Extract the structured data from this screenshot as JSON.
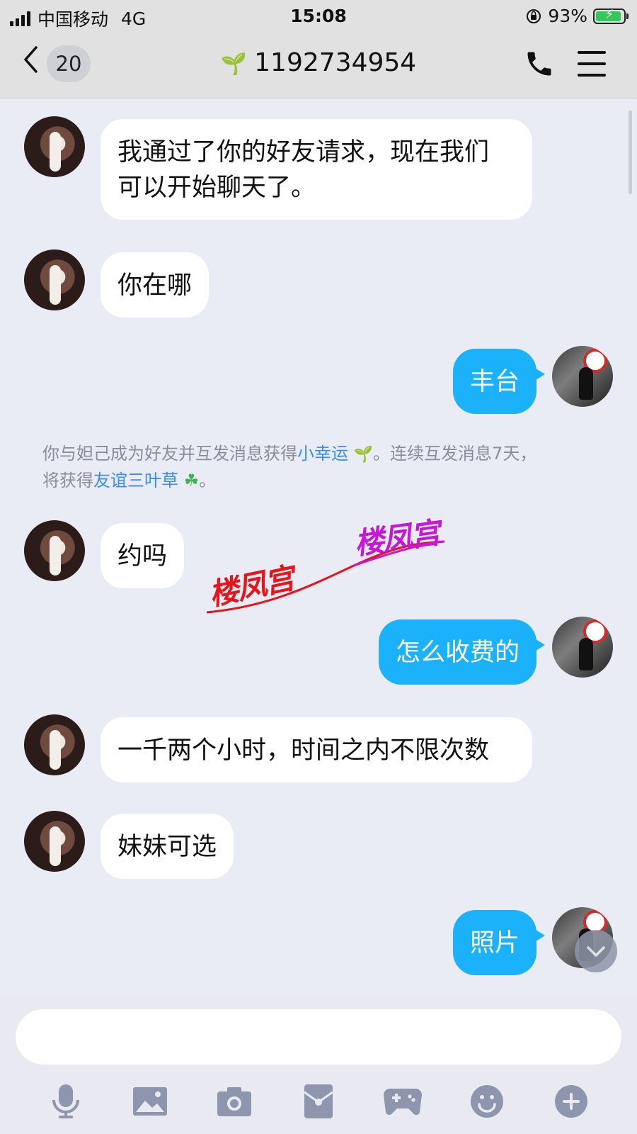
{
  "status_bar": {
    "carrier": "中国移动",
    "network": "4G",
    "time": "15:08",
    "battery": "93%",
    "battery_level": 0.93
  },
  "header": {
    "back_icon": "chevron-left-icon",
    "unread_count": "20",
    "title": "1192734954",
    "call_icon": "phone-icon",
    "menu_icon": "menu-icon"
  },
  "messages": [
    {
      "from": "her",
      "text_lines": [
        "我通过了你的好友请求，现在我们",
        "可以开始聊天了。"
      ]
    },
    {
      "from": "her",
      "text": "你在哪"
    },
    {
      "from": "me",
      "text": "丰台"
    },
    {
      "from": "system",
      "parts": [
        "你与妲己成为好友并互发消息获得",
        "小幸运",
        "。连续互发消息7天，",
        "将获得",
        "友谊三叶草",
        "。"
      ]
    },
    {
      "from": "her",
      "text": "约吗"
    },
    {
      "from": "me",
      "text": "怎么收费的"
    },
    {
      "from": "her",
      "text": "一千两个小时，时间之内不限次数"
    },
    {
      "from": "her",
      "text": "妹妹可选"
    },
    {
      "from": "me",
      "text": "照片"
    }
  ],
  "watermark": {
    "text1": "楼凤宫",
    "text2": "楼凤宫",
    "color1": "#e4161b",
    "color2": "#c516d9"
  },
  "input": {
    "value": "",
    "placeholder": ""
  },
  "toolbar": {
    "icons": [
      "microphone-icon",
      "image-icon",
      "camera-icon",
      "red-packet-icon",
      "game-icon",
      "emoji-icon",
      "plus-icon"
    ]
  },
  "colors": {
    "outgoing_bubble": "#1cb1fb",
    "incoming_bubble": "#ffffff",
    "background": "#e9ebf5",
    "link": "#3b8ef0"
  }
}
